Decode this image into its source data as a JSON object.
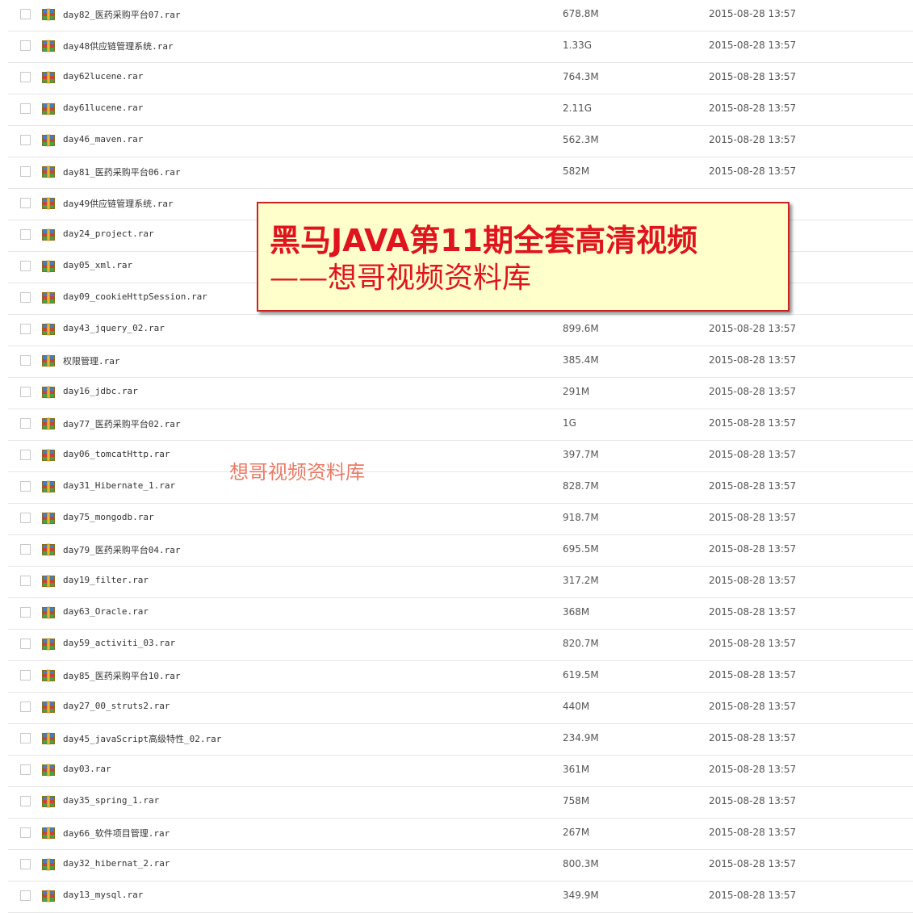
{
  "colors": {
    "watermark_red": "#e0141e",
    "watermark_bg": "#ffffcc",
    "row_divider": "#e6e6e6"
  },
  "icons": {
    "file": "rar-archive-icon",
    "checkbox": "checkbox"
  },
  "files": [
    {
      "name": "day82_医药采购平台07.rar",
      "size": "678.8M",
      "date": "2015-08-28 13:57"
    },
    {
      "name": "day48供应链管理系统.rar",
      "size": "1.33G",
      "date": "2015-08-28 13:57"
    },
    {
      "name": "day62lucene.rar",
      "size": "764.3M",
      "date": "2015-08-28 13:57"
    },
    {
      "name": "day61lucene.rar",
      "size": "2.11G",
      "date": "2015-08-28 13:57"
    },
    {
      "name": "day46_maven.rar",
      "size": "562.3M",
      "date": "2015-08-28 13:57"
    },
    {
      "name": "day81_医药采购平台06.rar",
      "size": "582M",
      "date": "2015-08-28 13:57"
    },
    {
      "name": "day49供应链管理系统.rar",
      "size": "",
      "date": ""
    },
    {
      "name": "day24_project.rar",
      "size": "",
      "date": ""
    },
    {
      "name": "day05_xml.rar",
      "size": "",
      "date": ""
    },
    {
      "name": "day09_cookieHttpSession.rar",
      "size": "",
      "date": ""
    },
    {
      "name": "day43_jquery_02.rar",
      "size": "899.6M",
      "date": "2015-08-28 13:57"
    },
    {
      "name": "权限管理.rar",
      "size": "385.4M",
      "date": "2015-08-28 13:57"
    },
    {
      "name": "day16_jdbc.rar",
      "size": "291M",
      "date": "2015-08-28 13:57"
    },
    {
      "name": "day77_医药采购平台02.rar",
      "size": "1G",
      "date": "2015-08-28 13:57"
    },
    {
      "name": "day06_tomcatHttp.rar",
      "size": "397.7M",
      "date": "2015-08-28 13:57"
    },
    {
      "name": "day31_Hibernate_1.rar",
      "size": "828.7M",
      "date": "2015-08-28 13:57"
    },
    {
      "name": "day75_mongodb.rar",
      "size": "918.7M",
      "date": "2015-08-28 13:57"
    },
    {
      "name": "day79_医药采购平台04.rar",
      "size": "695.5M",
      "date": "2015-08-28 13:57"
    },
    {
      "name": "day19_filter.rar",
      "size": "317.2M",
      "date": "2015-08-28 13:57"
    },
    {
      "name": "day63_Oracle.rar",
      "size": "368M",
      "date": "2015-08-28 13:57"
    },
    {
      "name": "day59_activiti_03.rar",
      "size": "820.7M",
      "date": "2015-08-28 13:57"
    },
    {
      "name": "day85_医药采购平台10.rar",
      "size": "619.5M",
      "date": "2015-08-28 13:57"
    },
    {
      "name": "day27_00_struts2.rar",
      "size": "440M",
      "date": "2015-08-28 13:57"
    },
    {
      "name": "day45_javaScript高级特性_02.rar",
      "size": "234.9M",
      "date": "2015-08-28 13:57"
    },
    {
      "name": "day03.rar",
      "size": "361M",
      "date": "2015-08-28 13:57"
    },
    {
      "name": "day35_spring_1.rar",
      "size": "758M",
      "date": "2015-08-28 13:57"
    },
    {
      "name": "day66_软件项目管理.rar",
      "size": "267M",
      "date": "2015-08-28 13:57"
    },
    {
      "name": "day32_hibernat_2.rar",
      "size": "800.3M",
      "date": "2015-08-28 13:57"
    },
    {
      "name": "day13_mysql.rar",
      "size": "349.9M",
      "date": "2015-08-28 13:57"
    }
  ],
  "watermark": {
    "line1": "黑马JAVA第11期全套高清视频",
    "line2": "——想哥视频资料库",
    "small": "想哥视频资料库"
  }
}
